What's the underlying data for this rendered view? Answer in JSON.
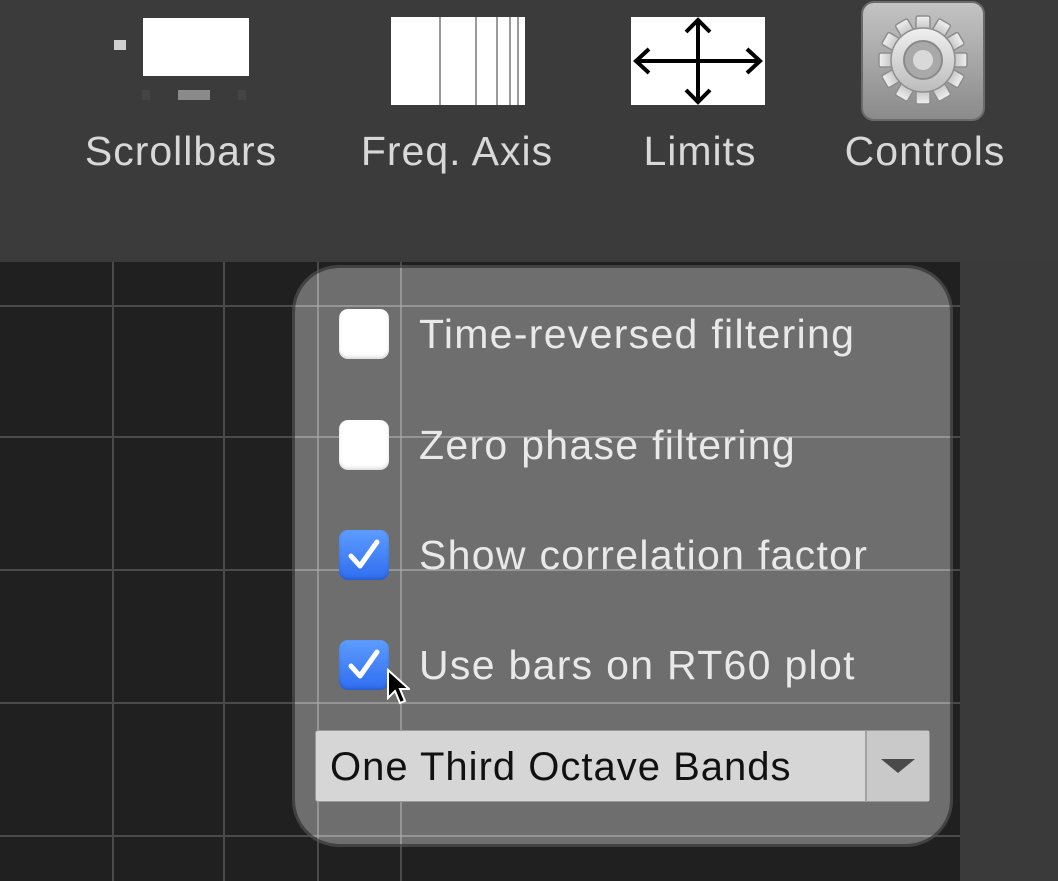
{
  "toolbar": {
    "scrollbars_label": "Scrollbars",
    "freq_axis_label": "Freq. Axis",
    "limits_label": "Limits",
    "controls_label": "Controls"
  },
  "controls_panel": {
    "options": [
      {
        "label": "Time-reversed filtering",
        "checked": false
      },
      {
        "label": "Zero phase filtering",
        "checked": false
      },
      {
        "label": "Show correlation factor",
        "checked": true
      },
      {
        "label": "Use bars on RT60 plot",
        "checked": true
      }
    ],
    "band_select": {
      "value": "One Third Octave Bands"
    }
  },
  "colors": {
    "accent_checkbox": "#3d7ff5",
    "toolbar_bg": "#3b3b3b",
    "plot_bg": "#202020"
  }
}
